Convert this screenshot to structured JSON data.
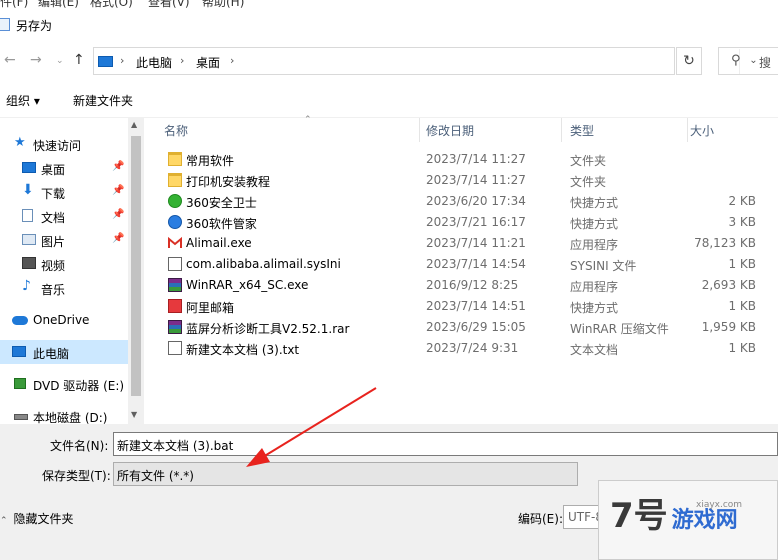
{
  "menubar": {
    "items": [
      "件(F)",
      "编辑(E)",
      "格式(O)",
      "查看(V)",
      "帮助(H)"
    ]
  },
  "window": {
    "title": "另存为"
  },
  "address": {
    "crumbs": [
      "此电脑",
      "桌面"
    ],
    "search_placeholder": "搜"
  },
  "toolbar": {
    "organize": "组织 ▾",
    "new_folder": "新建文件夹"
  },
  "nav": [
    {
      "label": "快速访问",
      "icon": "star-icon",
      "pinned": false
    },
    {
      "label": "桌面",
      "icon": "desktop-icon",
      "pinned": true
    },
    {
      "label": "下载",
      "icon": "download-icon",
      "pinned": true
    },
    {
      "label": "文档",
      "icon": "document-icon",
      "pinned": true
    },
    {
      "label": "图片",
      "icon": "picture-icon",
      "pinned": true
    },
    {
      "label": "视频",
      "icon": "video-icon",
      "pinned": false
    },
    {
      "label": "音乐",
      "icon": "music-icon",
      "pinned": false
    },
    {
      "label": "OneDrive",
      "icon": "cloud-icon",
      "pinned": false
    },
    {
      "label": "此电脑",
      "icon": "computer-icon",
      "pinned": false,
      "selected": true
    },
    {
      "label": "DVD 驱动器 (E:) (",
      "icon": "dvd-icon",
      "pinned": false
    },
    {
      "label": "本地磁盘 (D:)",
      "icon": "disk-icon",
      "pinned": false
    }
  ],
  "columns": [
    "名称",
    "修改日期",
    "类型",
    "大小"
  ],
  "files": [
    {
      "name": "常用软件",
      "date": "2023/7/14 11:27",
      "type": "文件夹",
      "size": "",
      "icon": "folder-icon"
    },
    {
      "name": "打印机安装教程",
      "date": "2023/7/14 11:27",
      "type": "文件夹",
      "size": "",
      "icon": "folder-icon"
    },
    {
      "name": "360安全卫士",
      "date": "2023/6/20 17:34",
      "type": "快捷方式",
      "size": "2 KB",
      "icon": "360-security-icon"
    },
    {
      "name": "360软件管家",
      "date": "2023/7/21 16:17",
      "type": "快捷方式",
      "size": "3 KB",
      "icon": "360-manager-icon"
    },
    {
      "name": "Alimail.exe",
      "date": "2023/7/14 11:21",
      "type": "应用程序",
      "size": "78,123 KB",
      "icon": "alimail-exe-icon"
    },
    {
      "name": "com.alibaba.alimail.sysIni",
      "date": "2023/7/14 14:54",
      "type": "SYSINI 文件",
      "size": "1 KB",
      "icon": "text-file-icon"
    },
    {
      "name": "WinRAR_x64_SC.exe",
      "date": "2016/9/12 8:25",
      "type": "应用程序",
      "size": "2,693 KB",
      "icon": "winrar-icon"
    },
    {
      "name": "阿里邮箱",
      "date": "2023/7/14 14:51",
      "type": "快捷方式",
      "size": "1 KB",
      "icon": "mail-icon"
    },
    {
      "name": "蓝屏分析诊断工具V2.52.1.rar",
      "date": "2023/6/29 15:05",
      "type": "WinRAR 压缩文件",
      "size": "1,959 KB",
      "icon": "rar-archive-icon"
    },
    {
      "name": "新建文本文档 (3).txt",
      "date": "2023/7/24 9:31",
      "type": "文本文档",
      "size": "1 KB",
      "icon": "text-file-icon"
    }
  ],
  "form": {
    "filename_label": "文件名(N):",
    "filename_value": "新建文本文档 (3).bat",
    "filetype_label": "保存类型(T):",
    "filetype_value": "所有文件  (*.*)",
    "hide_folders": "隐藏文件夹",
    "encoding_label": "编码(E):",
    "encoding_value": "UTF-8"
  },
  "watermark": {
    "logo": "7号",
    "text": "游戏网",
    "domain": "xiayx.com"
  },
  "colors": {
    "selected": "#cce8ff",
    "arrow": "#e8231e",
    "folder": "#ffd766"
  }
}
